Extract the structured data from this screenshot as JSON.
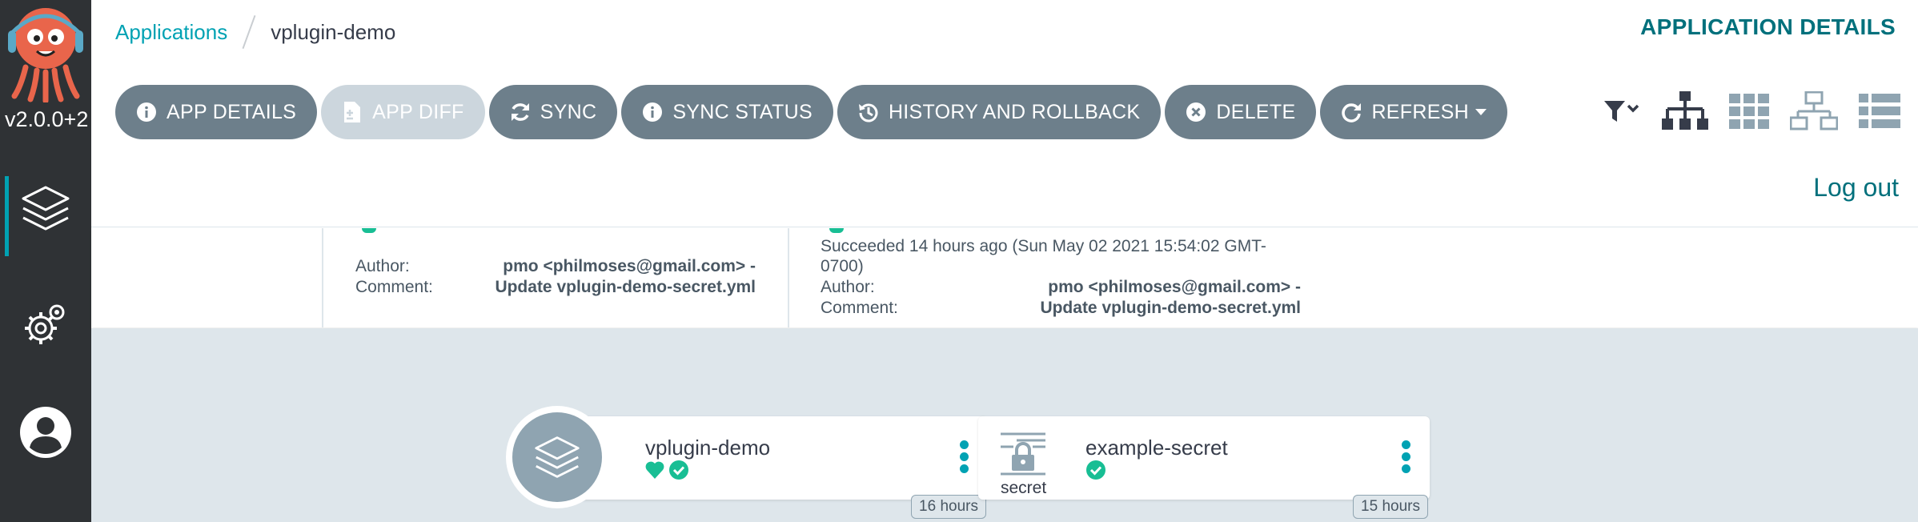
{
  "sidebar": {
    "version": "v2.0.0+2",
    "items": [
      {
        "name": "applications",
        "icon": "layers-icon"
      },
      {
        "name": "settings",
        "icon": "gears-icon"
      },
      {
        "name": "user-info",
        "icon": "user-icon"
      }
    ]
  },
  "breadcrumb": {
    "parent": "Applications",
    "current": "vplugin-demo"
  },
  "page_title": "APPLICATION DETAILS",
  "toolbar": {
    "app_details": "APP DETAILS",
    "app_diff": "APP DIFF",
    "sync": "SYNC",
    "sync_status": "SYNC STATUS",
    "history": "HISTORY AND ROLLBACK",
    "delete": "DELETE",
    "refresh": "REFRESH"
  },
  "logout": "Log out",
  "status": {
    "sync": {
      "author_label": "Author:",
      "author_value": "pmo <philmoses@gmail.com> -",
      "comment_label": "Comment:",
      "comment_value": "Update vplugin-demo-secret.yml"
    },
    "operation": {
      "succeeded": "Succeeded 14 hours ago (Sun May 02 2021 15:54:02 GMT-0700)",
      "author_label": "Author:",
      "author_value": "pmo <philmoses@gmail.com> -",
      "comment_label": "Comment:",
      "comment_value": "Update vplugin-demo-secret.yml"
    }
  },
  "graph": {
    "app_node": {
      "name": "vplugin-demo",
      "age": "16 hours",
      "health": "Healthy",
      "sync": "Synced"
    },
    "resource_node": {
      "name": "example-secret",
      "kind": "secret",
      "age": "15 hours",
      "sync": "Synced"
    }
  },
  "colors": {
    "accent": "#00a2b3",
    "title": "#00707c",
    "button": "#6d7f8b",
    "healthy": "#18be94"
  }
}
